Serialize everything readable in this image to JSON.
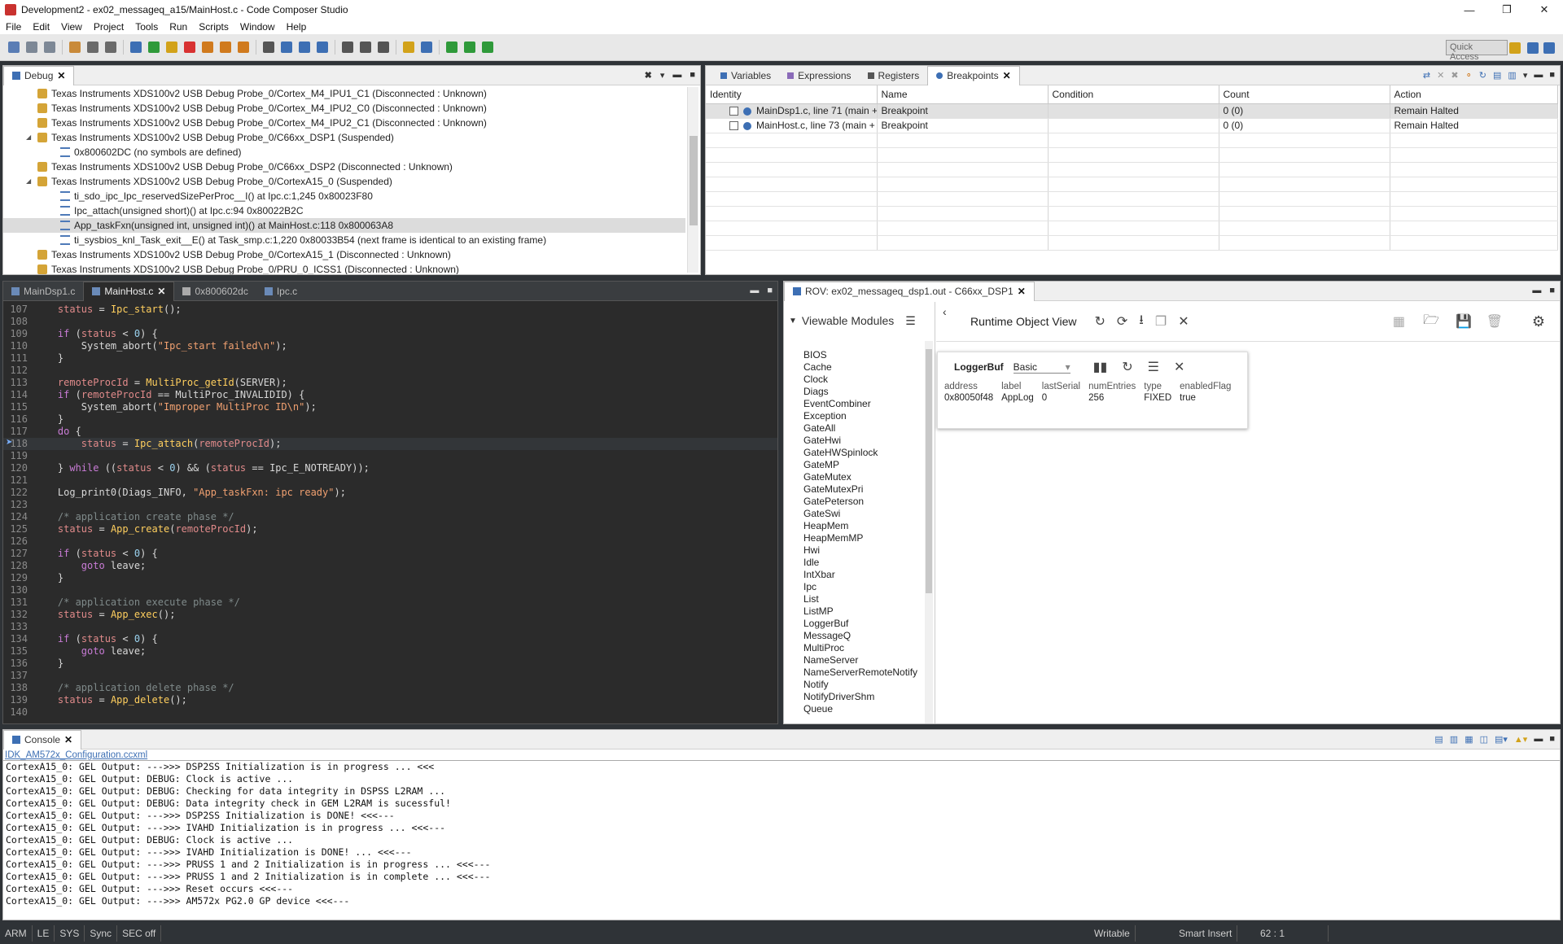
{
  "window": {
    "title": "Development2 - ex02_messageq_a15/MainHost.c - Code Composer Studio"
  },
  "menu": [
    "File",
    "Edit",
    "View",
    "Project",
    "Tools",
    "Run",
    "Scripts",
    "Window",
    "Help"
  ],
  "toolbar": {
    "quick_access": "Quick Access"
  },
  "debug": {
    "tab": "Debug",
    "rows": [
      {
        "text": "Texas Instruments XDS100v2 USB Debug Probe_0/Cortex_M4_IPU1_C1 (Disconnected : Unknown)",
        "kind": "probe",
        "indent": 1
      },
      {
        "text": "Texas Instruments XDS100v2 USB Debug Probe_0/Cortex_M4_IPU2_C0 (Disconnected : Unknown)",
        "kind": "probe",
        "indent": 1
      },
      {
        "text": "Texas Instruments XDS100v2 USB Debug Probe_0/Cortex_M4_IPU2_C1 (Disconnected : Unknown)",
        "kind": "probe",
        "indent": 1
      },
      {
        "text": "Texas Instruments XDS100v2 USB Debug Probe_0/C66xx_DSP1 (Suspended)",
        "kind": "probe-open",
        "indent": 1
      },
      {
        "text": "0x800602DC  (no symbols are defined)",
        "kind": "frame",
        "indent": 2
      },
      {
        "text": "Texas Instruments XDS100v2 USB Debug Probe_0/C66xx_DSP2 (Disconnected : Unknown)",
        "kind": "probe",
        "indent": 1
      },
      {
        "text": "Texas Instruments XDS100v2 USB Debug Probe_0/CortexA15_0 (Suspended)",
        "kind": "probe-open",
        "indent": 1
      },
      {
        "text": "ti_sdo_ipc_Ipc_reservedSizePerProc__I() at Ipc.c:1,245 0x80023F80",
        "kind": "frame",
        "indent": 2
      },
      {
        "text": "Ipc_attach(unsigned short)() at Ipc.c:94 0x80022B2C",
        "kind": "frame",
        "indent": 2
      },
      {
        "text": "App_taskFxn(unsigned int, unsigned int)() at MainHost.c:118 0x800063A8",
        "kind": "frame-sel",
        "indent": 2
      },
      {
        "text": "ti_sysbios_knl_Task_exit__E() at Task_smp.c:1,220 0x80033B54  (next frame is identical to an existing frame)",
        "kind": "frame",
        "indent": 2
      },
      {
        "text": "Texas Instruments XDS100v2 USB Debug Probe_0/CortexA15_1 (Disconnected : Unknown)",
        "kind": "probe",
        "indent": 1
      },
      {
        "text": "Texas Instruments XDS100v2 USB Debug Probe_0/PRU_0_ICSS1 (Disconnected : Unknown)",
        "kind": "probe",
        "indent": 1
      }
    ]
  },
  "views": {
    "tabs": [
      "Variables",
      "Expressions",
      "Registers",
      "Breakpoints"
    ],
    "columns": [
      "Identity",
      "Name",
      "Condition",
      "Count",
      "Action"
    ],
    "rows": [
      {
        "identity": "MainDsp1.c, line 71 (main +",
        "name": "Breakpoint",
        "condition": "",
        "count": "0 (0)",
        "action": "Remain Halted"
      },
      {
        "identity": "MainHost.c, line 73 (main +",
        "name": "Breakpoint",
        "condition": "",
        "count": "0 (0)",
        "action": "Remain Halted"
      }
    ]
  },
  "editor": {
    "tabs": [
      "MainDsp1.c",
      "MainHost.c",
      "0x800602dc",
      "Ipc.c"
    ],
    "lines": [
      {
        "n": "107",
        "t": "    status = Ipc_start();"
      },
      {
        "n": "108",
        "t": ""
      },
      {
        "n": "109",
        "t": "    if (status < 0) {"
      },
      {
        "n": "110",
        "t": "        System_abort(\"Ipc_start failed\\n\");"
      },
      {
        "n": "111",
        "t": "    }"
      },
      {
        "n": "112",
        "t": ""
      },
      {
        "n": "113",
        "t": "    remoteProcId = MultiProc_getId(SERVER);"
      },
      {
        "n": "114",
        "t": "    if (remoteProcId == MultiProc_INVALIDID) {"
      },
      {
        "n": "115",
        "t": "        System_abort(\"Improper MultiProc ID\\n\");"
      },
      {
        "n": "116",
        "t": "    }"
      },
      {
        "n": "117",
        "t": "    do {"
      },
      {
        "n": "118",
        "t": "        status = Ipc_attach(remoteProcId);"
      },
      {
        "n": "119",
        "t": ""
      },
      {
        "n": "120",
        "t": "    } while ((status < 0) && (status == Ipc_E_NOTREADY));"
      },
      {
        "n": "121",
        "t": ""
      },
      {
        "n": "122",
        "t": "    Log_print0(Diags_INFO, \"App_taskFxn: ipc ready\");"
      },
      {
        "n": "123",
        "t": ""
      },
      {
        "n": "124",
        "t": "    /* application create phase */"
      },
      {
        "n": "125",
        "t": "    status = App_create(remoteProcId);"
      },
      {
        "n": "126",
        "t": ""
      },
      {
        "n": "127",
        "t": "    if (status < 0) {"
      },
      {
        "n": "128",
        "t": "        goto leave;"
      },
      {
        "n": "129",
        "t": "    }"
      },
      {
        "n": "130",
        "t": ""
      },
      {
        "n": "131",
        "t": "    /* application execute phase */"
      },
      {
        "n": "132",
        "t": "    status = App_exec();"
      },
      {
        "n": "133",
        "t": ""
      },
      {
        "n": "134",
        "t": "    if (status < 0) {"
      },
      {
        "n": "135",
        "t": "        goto leave;"
      },
      {
        "n": "136",
        "t": "    }"
      },
      {
        "n": "137",
        "t": ""
      },
      {
        "n": "138",
        "t": "    /* application delete phase */"
      },
      {
        "n": "139",
        "t": "    status = App_delete();"
      },
      {
        "n": "140",
        "t": ""
      }
    ]
  },
  "rov": {
    "tab": "ROV: ex02_messageq_dsp1.out - C66xx_DSP1",
    "modules_title": "Viewable Modules",
    "view_title": "Runtime Object View",
    "modules": [
      "BIOS",
      "Cache",
      "Clock",
      "Diags",
      "EventCombiner",
      "Exception",
      "GateAll",
      "GateHwi",
      "GateHWSpinlock",
      "GateMP",
      "GateMutex",
      "GateMutexPri",
      "GatePeterson",
      "GateSwi",
      "HeapMem",
      "HeapMemMP",
      "Hwi",
      "Idle",
      "IntXbar",
      "Ipc",
      "List",
      "ListMP",
      "LoggerBuf",
      "MessageQ",
      "MultiProc",
      "NameServer",
      "NameServerRemoteNotify",
      "Notify",
      "NotifyDriverShm",
      "Queue"
    ],
    "card": {
      "title": "LoggerBuf",
      "view_select": "Basic",
      "columns": [
        "address",
        "label",
        "lastSerial",
        "numEntries",
        "type",
        "enabledFlag"
      ],
      "row": [
        "0x80050f48",
        "AppLog",
        "0",
        "256",
        "FIXED",
        "true"
      ]
    }
  },
  "console": {
    "tab": "Console",
    "config": "IDK_AM572x_Configuration.ccxml",
    "lines": [
      "CortexA15_0: GEL Output: --->>> DSP2SS Initialization is in progress ... <<<",
      "CortexA15_0: GEL Output: DEBUG: Clock is active ...",
      "CortexA15_0: GEL Output: DEBUG: Checking for data integrity in DSPSS L2RAM ...",
      "CortexA15_0: GEL Output: DEBUG: Data integrity check in GEM L2RAM is sucessful!",
      "CortexA15_0: GEL Output: --->>> DSP2SS Initialization is DONE! <<<---",
      "CortexA15_0: GEL Output: --->>> IVAHD Initialization is in progress ... <<<---",
      "CortexA15_0: GEL Output: DEBUG: Clock is active ...",
      "CortexA15_0: GEL Output: --->>> IVAHD Initialization is DONE! ... <<<---",
      "CortexA15_0: GEL Output: --->>> PRUSS 1 and 2 Initialization is in progress ... <<<---",
      "CortexA15_0: GEL Output: --->>> PRUSS 1 and 2 Initialization is in complete ... <<<---",
      "CortexA15_0: GEL Output: --->>> Reset occurs <<<---",
      "CortexA15_0: GEL Output: --->>> AM572x PG2.0 GP device <<<---"
    ]
  },
  "status": {
    "left": [
      "ARM",
      "LE",
      "SYS",
      "Sync",
      "SEC off"
    ],
    "writable": "Writable",
    "insert": "Smart Insert",
    "pos": "62 : 1"
  }
}
